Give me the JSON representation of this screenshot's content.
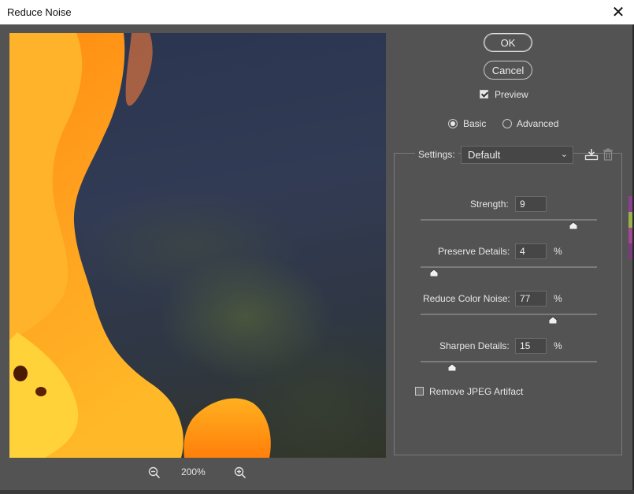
{
  "window": {
    "title": "Reduce Noise",
    "close_glyph": "✕"
  },
  "preview": {
    "zoom_level": "200%",
    "zoom_out_icon": "zoom-out-icon",
    "zoom_in_icon": "zoom-in-icon"
  },
  "buttons": {
    "ok": "OK",
    "cancel": "Cancel"
  },
  "preview_toggle": {
    "label": "Preview",
    "checked": true
  },
  "mode": {
    "basic": "Basic",
    "advanced": "Advanced",
    "selected": "basic"
  },
  "settings": {
    "label": "Settings:",
    "value": "Default",
    "save_icon": "save-preset-icon",
    "delete_icon": "trash-icon"
  },
  "controls": {
    "strength": {
      "label": "Strength:",
      "value": "9",
      "unit": "",
      "max": 10
    },
    "preserve_details": {
      "label": "Preserve Details:",
      "value": "4",
      "unit": "%",
      "max": 100
    },
    "reduce_color_noise": {
      "label": "Reduce Color Noise:",
      "value": "77",
      "unit": "%",
      "max": 100
    },
    "sharpen_details": {
      "label": "Sharpen Details:",
      "value": "15",
      "unit": "%",
      "max": 100
    }
  },
  "remove_jpeg": {
    "label": "Remove JPEG Artifact",
    "checked": false
  },
  "colors": {
    "dialog_bg": "#535353",
    "title_bg": "#ffffff",
    "preview_flame": "#ff9f1a"
  }
}
